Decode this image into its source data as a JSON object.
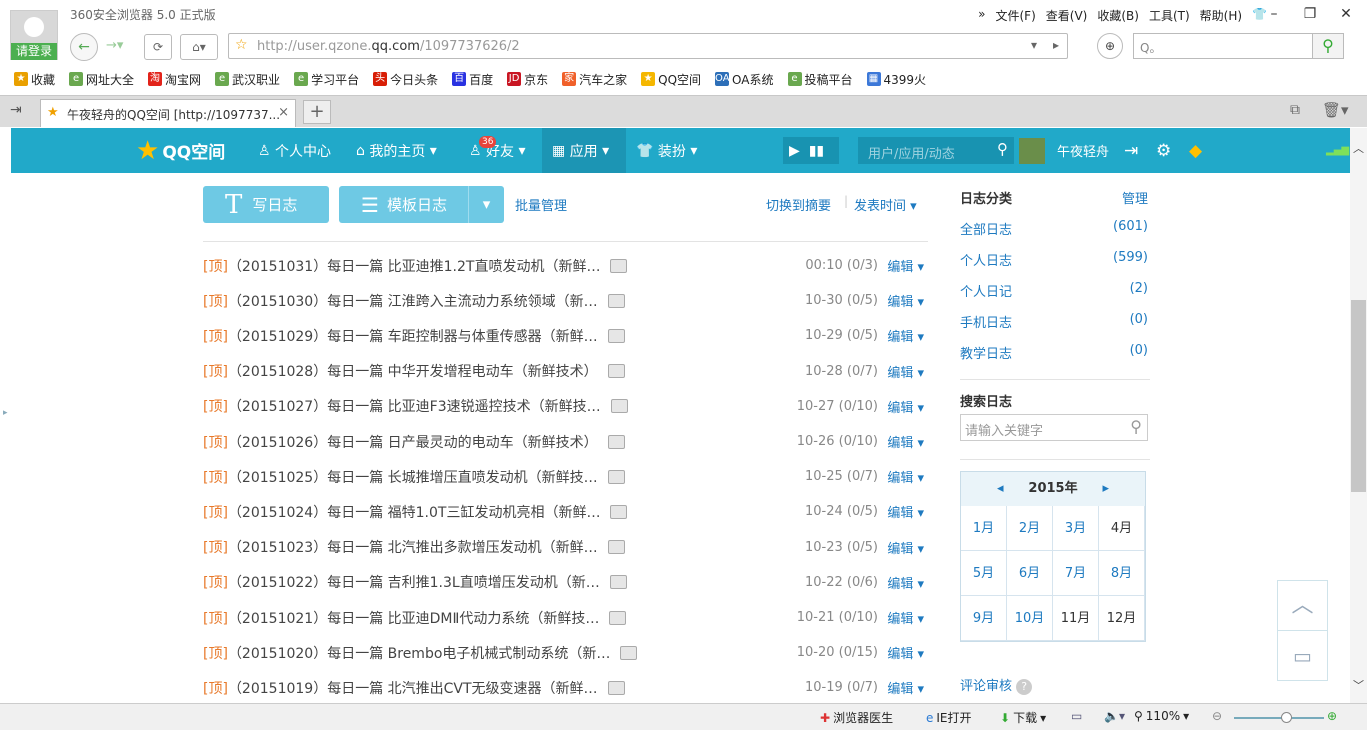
{
  "window": {
    "title": "360安全浏览器 5.0 正式版",
    "login": "请登录",
    "menu": [
      "文件(F)",
      "查看(V)",
      "收藏(B)",
      "工具(T)",
      "帮助(H)"
    ]
  },
  "address": {
    "url_pre": "http://user.qzone.",
    "url_domain": "qq.com",
    "url_post": "/1097737626/2",
    "search_placeholder": "Q。"
  },
  "bookmarks": [
    {
      "label": "收藏",
      "color": "#e9a000",
      "icon": "★"
    },
    {
      "label": "网址大全",
      "color": "#6aa84f",
      "icon": "e"
    },
    {
      "label": "淘宝网",
      "color": "#e2231a",
      "icon": "淘"
    },
    {
      "label": "武汉职业",
      "color": "#6aa84f",
      "icon": "e"
    },
    {
      "label": "学习平台",
      "color": "#6aa84f",
      "icon": "e"
    },
    {
      "label": "今日头条",
      "color": "#d81e06",
      "icon": "头"
    },
    {
      "label": "百度",
      "color": "#2932e1",
      "icon": "百"
    },
    {
      "label": "京东",
      "color": "#c91623",
      "icon": "JD"
    },
    {
      "label": "汽车之家",
      "color": "#f0602a",
      "icon": "家"
    },
    {
      "label": "QQ空间",
      "color": "#f5b700",
      "icon": "★"
    },
    {
      "label": "OA系统",
      "color": "#2d6fb8",
      "icon": "OA"
    },
    {
      "label": "投稿平台",
      "color": "#6aa84f",
      "icon": "e"
    },
    {
      "label": "4399火",
      "color": "#3c78d8",
      "icon": "▦"
    }
  ],
  "tab": {
    "label": "午夜轻舟的QQ空间 [http://1097737...",
    "close": "×",
    "new": "+"
  },
  "qzone": {
    "logo": "QQ空间",
    "nav": [
      "个人中心",
      "我的主页",
      "好友",
      "应用",
      "装扮"
    ],
    "friend_badge": "36",
    "search_placeholder": "用户/应用/动态",
    "username": "午夜轻舟"
  },
  "toolbar": {
    "write": "写日志",
    "template": "模板日志",
    "batch": "批量管理",
    "switch": "切换到摘要",
    "sort": "发表时间"
  },
  "posts": [
    {
      "tag": "[顶]",
      "title": "（20151031）每日一篇 比亚迪推1.2T直喷发动机（新鲜…",
      "date": "00:10",
      "count": "(0/3)",
      "edit": "编辑"
    },
    {
      "tag": "[顶]",
      "title": "（20151030）每日一篇 江淮跨入主流动力系统领域（新…",
      "date": "10-30",
      "count": "(0/5)",
      "edit": "编辑"
    },
    {
      "tag": "[顶]",
      "title": "（20151029）每日一篇 车距控制器与体重传感器（新鲜…",
      "date": "10-29",
      "count": "(0/5)",
      "edit": "编辑"
    },
    {
      "tag": "[顶]",
      "title": "（20151028）每日一篇 中华开发增程电动车（新鲜技术）",
      "date": "10-28",
      "count": "(0/7)",
      "edit": "编辑"
    },
    {
      "tag": "[顶]",
      "title": "（20151027）每日一篇 比亚迪F3速锐遥控技术（新鲜技…",
      "date": "10-27",
      "count": "(0/10)",
      "edit": "编辑"
    },
    {
      "tag": "[顶]",
      "title": "（20151026）每日一篇 日产最灵动的电动车（新鲜技术）",
      "date": "10-26",
      "count": "(0/10)",
      "edit": "编辑"
    },
    {
      "tag": "[顶]",
      "title": "（20151025）每日一篇 长城推增压直喷发动机（新鲜技…",
      "date": "10-25",
      "count": "(0/7)",
      "edit": "编辑"
    },
    {
      "tag": "[顶]",
      "title": "（20151024）每日一篇 福特1.0T三缸发动机亮相（新鲜…",
      "date": "10-24",
      "count": "(0/5)",
      "edit": "编辑"
    },
    {
      "tag": "[顶]",
      "title": "（20151023）每日一篇 北汽推出多款增压发动机（新鲜…",
      "date": "10-23",
      "count": "(0/5)",
      "edit": "编辑"
    },
    {
      "tag": "[顶]",
      "title": "（20151022）每日一篇 吉利推1.3L直喷增压发动机（新…",
      "date": "10-22",
      "count": "(0/6)",
      "edit": "编辑"
    },
    {
      "tag": "[顶]",
      "title": "（20151021）每日一篇 比亚迪DMⅡ代动力系统（新鲜技…",
      "date": "10-21",
      "count": "(0/10)",
      "edit": "编辑"
    },
    {
      "tag": "[顶]",
      "title": "（20151020）每日一篇 Brembo电子机械式制动系统（新…",
      "date": "10-20",
      "count": "(0/15)",
      "edit": "编辑"
    },
    {
      "tag": "[顶]",
      "title": "（20151019）每日一篇 北汽推出CVT无级变速器（新鲜…",
      "date": "10-19",
      "count": "(0/7)",
      "edit": "编辑"
    }
  ],
  "sidebar": {
    "cat_title": "日志分类",
    "manage": "管理",
    "cats": [
      {
        "label": "全部日志",
        "n": "(601)"
      },
      {
        "label": "个人日志",
        "n": "(599)"
      },
      {
        "label": "个人日记",
        "n": "(2)"
      },
      {
        "label": "手机日志",
        "n": "(0)"
      },
      {
        "label": "教学日志",
        "n": "(0)"
      }
    ],
    "search_title": "搜索日志",
    "search_placeholder": "请输入关键字",
    "year": "2015年",
    "months": [
      "1月",
      "2月",
      "3月",
      "4月",
      "5月",
      "6月",
      "7月",
      "8月",
      "9月",
      "10月",
      "11月",
      "12月"
    ],
    "review": "评论审核"
  },
  "status": {
    "doctor": "浏览器医生",
    "ie": "IE打开",
    "download": "下载",
    "zoom": "110%"
  }
}
